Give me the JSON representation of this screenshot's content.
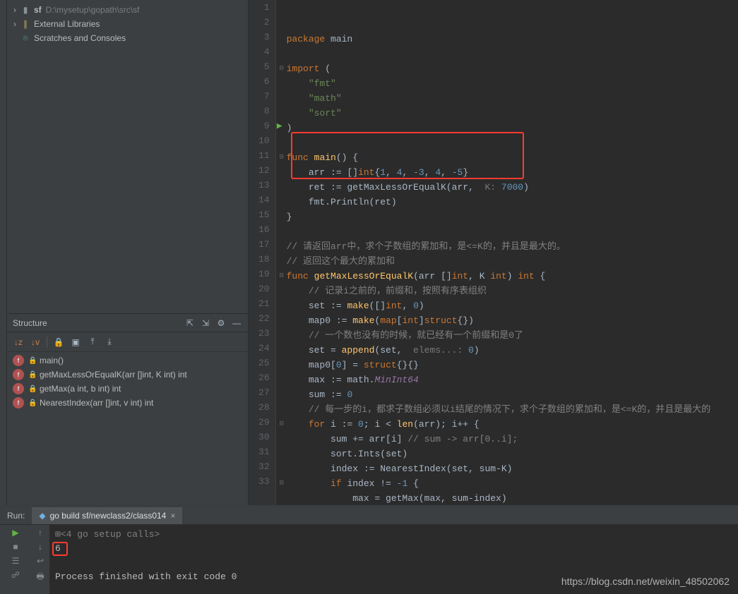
{
  "project": {
    "root_label": "sf",
    "root_path": "D:\\mysetup\\gopath\\src\\sf",
    "external": "External Libraries",
    "scratches": "Scratches and Consoles"
  },
  "structure": {
    "title": "Structure",
    "items": [
      {
        "label": "main()"
      },
      {
        "label": "getMaxLessOrEqualK(arr []int, K int) int"
      },
      {
        "label": "getMax(a int, b int) int"
      },
      {
        "label": "NearestIndex(arr []int, v int) int"
      }
    ]
  },
  "editor": {
    "lines": [
      {
        "n": 1,
        "tokens": [
          [
            "kw",
            "package"
          ],
          [
            "",
            " "
          ],
          [
            "",
            "main"
          ]
        ]
      },
      {
        "n": 2,
        "tokens": []
      },
      {
        "n": 3,
        "fold": true,
        "tokens": [
          [
            "kw",
            "import"
          ],
          [
            "",
            " ("
          ]
        ]
      },
      {
        "n": 4,
        "tokens": [
          [
            "",
            "    "
          ],
          [
            "str",
            "\"fmt\""
          ]
        ]
      },
      {
        "n": 5,
        "tokens": [
          [
            "",
            "    "
          ],
          [
            "str",
            "\"math\""
          ]
        ]
      },
      {
        "n": 6,
        "tokens": [
          [
            "",
            "    "
          ],
          [
            "str",
            "\"sort\""
          ]
        ]
      },
      {
        "n": 7,
        "tokens": [
          [
            "",
            ")"
          ]
        ]
      },
      {
        "n": 8,
        "tokens": []
      },
      {
        "n": 9,
        "run": true,
        "fold": true,
        "tokens": [
          [
            "kw",
            "func"
          ],
          [
            "",
            " "
          ],
          [
            "fn",
            "main"
          ],
          [
            "",
            "() {"
          ]
        ]
      },
      {
        "n": 10,
        "tokens": [
          [
            "",
            "    arr := []"
          ],
          [
            "typ",
            "int"
          ],
          [
            "",
            "{"
          ],
          [
            "num",
            "1"
          ],
          [
            "",
            ", "
          ],
          [
            "num",
            "4"
          ],
          [
            "",
            ", "
          ],
          [
            "num",
            "-3"
          ],
          [
            "",
            ", "
          ],
          [
            "num",
            "4"
          ],
          [
            "",
            ", "
          ],
          [
            "num",
            "-5"
          ],
          [
            "",
            "}"
          ]
        ]
      },
      {
        "n": 11,
        "tokens": [
          [
            "",
            "    ret := getMaxLessOrEqualK(arr,  "
          ],
          [
            "hint",
            "K:"
          ],
          [
            "",
            " "
          ],
          [
            "num",
            "7000"
          ],
          [
            "",
            ")"
          ]
        ]
      },
      {
        "n": 12,
        "tokens": [
          [
            "",
            "    fmt.Println(ret)"
          ]
        ]
      },
      {
        "n": 13,
        "tokens": [
          [
            "",
            "}"
          ]
        ]
      },
      {
        "n": 14,
        "tokens": []
      },
      {
        "n": 15,
        "tokens": [
          [
            "cm",
            "// 请返回arr中，求个子数组的累加和，是<=K的，并且是最大的。"
          ]
        ]
      },
      {
        "n": 16,
        "tokens": [
          [
            "cm",
            "// 返回这个最大的累加和"
          ]
        ]
      },
      {
        "n": 17,
        "fold": true,
        "tokens": [
          [
            "kw",
            "func"
          ],
          [
            "",
            " "
          ],
          [
            "fn",
            "getMaxLessOrEqualK"
          ],
          [
            "",
            "(arr []"
          ],
          [
            "typ",
            "int"
          ],
          [
            "",
            ", K "
          ],
          [
            "typ",
            "int"
          ],
          [
            "",
            ") "
          ],
          [
            "typ",
            "int"
          ],
          [
            "",
            " {"
          ]
        ]
      },
      {
        "n": 18,
        "tokens": [
          [
            "",
            "    "
          ],
          [
            "cm",
            "// 记录i之前的，前缀和，按照有序表组织"
          ]
        ]
      },
      {
        "n": 19,
        "tokens": [
          [
            "",
            "    set := "
          ],
          [
            "fn",
            "make"
          ],
          [
            "",
            "([]"
          ],
          [
            "typ",
            "int"
          ],
          [
            "",
            ", "
          ],
          [
            "num",
            "0"
          ],
          [
            "",
            ")"
          ]
        ]
      },
      {
        "n": 20,
        "tokens": [
          [
            "",
            "    map0 := "
          ],
          [
            "fn",
            "make"
          ],
          [
            "",
            "("
          ],
          [
            "kw",
            "map"
          ],
          [
            "",
            "["
          ],
          [
            "typ",
            "int"
          ],
          [
            "",
            "]"
          ],
          [
            "kw",
            "struct"
          ],
          [
            "",
            "{})"
          ]
        ]
      },
      {
        "n": 21,
        "tokens": [
          [
            "",
            "    "
          ],
          [
            "cm",
            "// 一个数也没有的时候，就已经有一个前缀和是0了"
          ]
        ]
      },
      {
        "n": 22,
        "tokens": [
          [
            "",
            "    set = "
          ],
          [
            "fn",
            "append"
          ],
          [
            "",
            "(set,  "
          ],
          [
            "hint",
            "elems...:"
          ],
          [
            "",
            " "
          ],
          [
            "num",
            "0"
          ],
          [
            "",
            ")"
          ]
        ]
      },
      {
        "n": 23,
        "tokens": [
          [
            "",
            "    map0["
          ],
          [
            "num",
            "0"
          ],
          [
            "",
            "] = "
          ],
          [
            "kw",
            "struct"
          ],
          [
            "",
            "{}{}"
          ]
        ]
      },
      {
        "n": 24,
        "tokens": [
          [
            "",
            "    max := math."
          ],
          [
            "ident",
            "MinInt64"
          ]
        ]
      },
      {
        "n": 25,
        "tokens": [
          [
            "",
            "    sum := "
          ],
          [
            "num",
            "0"
          ]
        ]
      },
      {
        "n": 26,
        "tokens": [
          [
            "",
            "    "
          ],
          [
            "cm",
            "// 每一步的i，都求子数组必须以i结尾的情况下，求个子数组的累加和，是<=K的，并且是最大的"
          ]
        ]
      },
      {
        "n": 27,
        "fold": true,
        "tokens": [
          [
            "",
            "    "
          ],
          [
            "kw",
            "for"
          ],
          [
            "",
            " i := "
          ],
          [
            "num",
            "0"
          ],
          [
            "",
            "; i < "
          ],
          [
            "fn",
            "len"
          ],
          [
            "",
            "(arr); i++ {"
          ]
        ]
      },
      {
        "n": 28,
        "tokens": [
          [
            "",
            "        sum += arr[i] "
          ],
          [
            "cm",
            "// sum -> arr[0..i];"
          ]
        ]
      },
      {
        "n": 29,
        "tokens": [
          [
            "",
            "        sort.Ints(set)"
          ]
        ]
      },
      {
        "n": 30,
        "tokens": [
          [
            "",
            "        index := NearestIndex(set, sum-K)"
          ]
        ]
      },
      {
        "n": 31,
        "fold": true,
        "tokens": [
          [
            "",
            "        "
          ],
          [
            "kw",
            "if"
          ],
          [
            "",
            " index != "
          ],
          [
            "num",
            "-1"
          ],
          [
            "",
            " {"
          ]
        ]
      },
      {
        "n": 32,
        "tokens": [
          [
            "",
            "            max = getMax(max, sum-index)"
          ]
        ]
      },
      {
        "n": 33,
        "tokens": [
          [
            "",
            "        }"
          ]
        ]
      }
    ],
    "highlight_box": {
      "top_line": 10,
      "bottom_line": 12
    }
  },
  "run": {
    "label": "Run:",
    "tab": "go build sf/newclass2/class014",
    "setup": "<4 go setup calls>",
    "output": "6",
    "exit": "Process finished with exit code 0"
  },
  "watermark": "https://blog.csdn.net/weixin_48502062"
}
